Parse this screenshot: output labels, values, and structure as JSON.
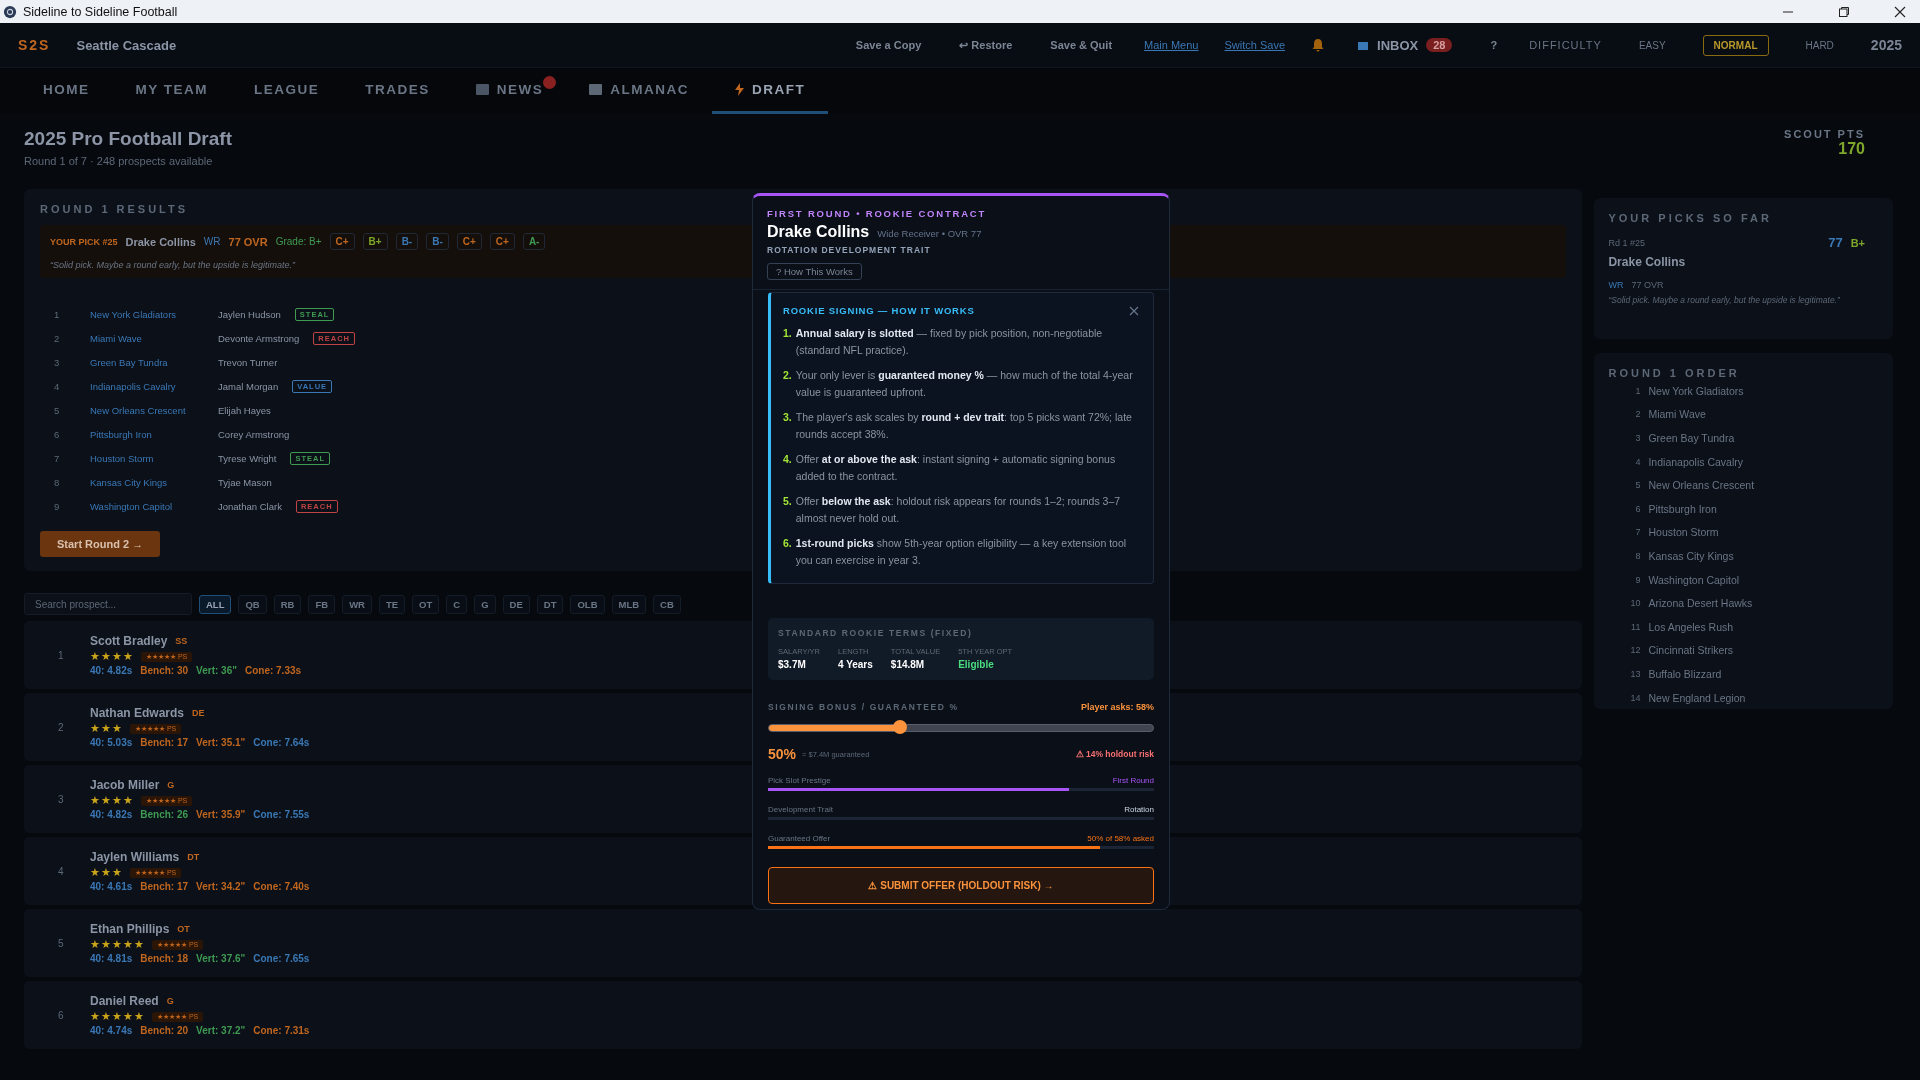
{
  "window": {
    "title": "Sideline to Sideline Football"
  },
  "header": {
    "logo": "S2S",
    "team": "Seattle Cascade",
    "actions": [
      "Save a Copy",
      "↩ Restore",
      "Save & Quit"
    ],
    "links": [
      "Main Menu",
      "Switch Save"
    ],
    "inbox": {
      "label": "INBOX",
      "count": "28"
    },
    "help": "?",
    "difficulty": {
      "label": "DIFFICULTY",
      "options": [
        {
          "label": "EASY",
          "selected": false
        },
        {
          "label": "NORMAL",
          "selected": true
        },
        {
          "label": "HARD",
          "selected": false
        }
      ]
    },
    "year": "2025"
  },
  "tabs": [
    {
      "label": "HOME",
      "selected": false,
      "kind": "plain"
    },
    {
      "label": "MY TEAM",
      "selected": false,
      "kind": "plain"
    },
    {
      "label": "LEAGUE",
      "selected": false,
      "kind": "plain"
    },
    {
      "label": "TRADES",
      "selected": false,
      "kind": "plain"
    },
    {
      "label": "NEWS",
      "selected": false,
      "kind": "news",
      "badge": true
    },
    {
      "label": "ALMANAC",
      "selected": false,
      "kind": "almanac"
    },
    {
      "label": "DRAFT",
      "selected": true,
      "kind": "draft"
    }
  ],
  "page": {
    "title": "2025 Pro Football Draft",
    "subtitle": "Round 1 of 7 · 248 prospects available",
    "scout": {
      "label": "SCOUT PTS",
      "value": "170"
    }
  },
  "results": {
    "title": "ROUND 1 RESULTS",
    "your_pick": {
      "label": "YOUR PICK #25",
      "name": "Drake Collins",
      "pos": "WR",
      "ovr": "77 OVR",
      "grade": "Grade: B+",
      "grades": [
        {
          "label": "C+",
          "color": "#c0661f"
        },
        {
          "label": "B+",
          "color": "#7ea62a"
        },
        {
          "label": "B-",
          "color": "#3a78b5"
        },
        {
          "label": "B-",
          "color": "#3a78b5"
        },
        {
          "label": "C+",
          "color": "#c0661f"
        },
        {
          "label": "C+",
          "color": "#c0661f"
        },
        {
          "label": "A-",
          "color": "#3f9a52"
        }
      ],
      "quote": "“Solid pick. Maybe a round early, but the upside is legitimate.”"
    },
    "picks": [
      {
        "num": "1",
        "team": "New York Gladiators",
        "player": "Jaylen Hudson",
        "tag": "STEAL",
        "color": "#3f9a52"
      },
      {
        "num": "2",
        "team": "Miami Wave",
        "player": "Devonte Armstrong",
        "tag": "REACH",
        "color": "#c04444"
      },
      {
        "num": "3",
        "team": "Green Bay Tundra",
        "player": "Trevon Turner"
      },
      {
        "num": "4",
        "team": "Indianapolis Cavalry",
        "player": "Jamal Morgan",
        "tag": "VALUE",
        "color": "#3a78b5"
      },
      {
        "num": "5",
        "team": "New Orleans Crescent",
        "player": "Elijah Hayes"
      },
      {
        "num": "6",
        "team": "Pittsburgh Iron",
        "player": "Corey Armstrong"
      },
      {
        "num": "7",
        "team": "Houston Storm",
        "player": "Tyrese Wright",
        "tag": "STEAL",
        "color": "#3f9a52"
      },
      {
        "num": "8",
        "team": "Kansas City Kings",
        "player": "Tyjae Mason"
      },
      {
        "num": "9",
        "team": "Washington Capitol",
        "player": "Jonathan Clark",
        "tag": "REACH",
        "color": "#c04444"
      }
    ],
    "next_button": "Start Round 2 →"
  },
  "filters": {
    "search": {
      "placeholder": "Search prospect..."
    },
    "positions": [
      {
        "label": "ALL",
        "selected": true
      },
      {
        "label": "QB",
        "selected": false
      },
      {
        "label": "RB",
        "selected": false
      },
      {
        "label": "FB",
        "selected": false
      },
      {
        "label": "WR",
        "selected": false
      },
      {
        "label": "TE",
        "selected": false
      },
      {
        "label": "OT",
        "selected": false
      },
      {
        "label": "C",
        "selected": false
      },
      {
        "label": "G",
        "selected": false
      },
      {
        "label": "DE",
        "selected": false
      },
      {
        "label": "DT",
        "selected": false
      },
      {
        "label": "OLB",
        "selected": false
      },
      {
        "label": "MLB",
        "selected": false
      },
      {
        "label": "CB",
        "selected": false
      }
    ]
  },
  "prospects": [
    {
      "rank": "1",
      "name": "Scott Bradley",
      "pos": "SS",
      "stars": 4,
      "potential": "★★★★★ PS",
      "stats": [
        {
          "text": "40: 4.82s",
          "color": "#3a78b5"
        },
        {
          "text": "Bench: 30",
          "color": "#c0661f"
        },
        {
          "text": "Vert: 36\"",
          "color": "#3f9a52"
        },
        {
          "text": "Cone: 7.33s",
          "color": "#c0661f"
        }
      ]
    },
    {
      "rank": "2",
      "name": "Nathan Edwards",
      "pos": "DE",
      "stars": 3,
      "potential": "★★★★★ PS",
      "stats": [
        {
          "text": "40: 5.03s",
          "color": "#3a78b5"
        },
        {
          "text": "Bench: 17",
          "color": "#c0661f"
        },
        {
          "text": "Vert: 35.1\"",
          "color": "#c0661f"
        },
        {
          "text": "Cone: 7.64s",
          "color": "#3a78b5"
        }
      ]
    },
    {
      "rank": "3",
      "name": "Jacob Miller",
      "pos": "G",
      "stars": 4,
      "potential": "★★★★★ PS",
      "stats": [
        {
          "text": "40: 4.82s",
          "color": "#3a78b5"
        },
        {
          "text": "Bench: 26",
          "color": "#3f9a52"
        },
        {
          "text": "Vert: 35.9\"",
          "color": "#c0661f"
        },
        {
          "text": "Cone: 7.55s",
          "color": "#3a78b5"
        }
      ]
    },
    {
      "rank": "4",
      "name": "Jaylen Williams",
      "pos": "DT",
      "stars": 3,
      "potential": "★★★★★ PS",
      "stats": [
        {
          "text": "40: 4.61s",
          "color": "#3a78b5"
        },
        {
          "text": "Bench: 17",
          "color": "#c0661f"
        },
        {
          "text": "Vert: 34.2\"",
          "color": "#c0661f"
        },
        {
          "text": "Cone: 7.40s",
          "color": "#c0661f"
        }
      ]
    },
    {
      "rank": "5",
      "name": "Ethan Phillips",
      "pos": "OT",
      "stars": 5,
      "potential": "★★★★★ PS",
      "stats": [
        {
          "text": "40: 4.81s",
          "color": "#3a78b5"
        },
        {
          "text": "Bench: 18",
          "color": "#c0661f"
        },
        {
          "text": "Vert: 37.6\"",
          "color": "#3f9a52"
        },
        {
          "text": "Cone: 7.65s",
          "color": "#3a78b5"
        }
      ]
    },
    {
      "rank": "6",
      "name": "Daniel Reed",
      "pos": "G",
      "stars": 5,
      "potential": "★★★★★ PS",
      "stats": [
        {
          "text": "40: 4.74s",
          "color": "#3a78b5"
        },
        {
          "text": "Bench: 20",
          "color": "#c0661f"
        },
        {
          "text": "Vert: 37.2\"",
          "color": "#3f9a52"
        },
        {
          "text": "Cone: 7.31s",
          "color": "#c0661f"
        }
      ]
    }
  ],
  "sidebar": {
    "picks": {
      "title": "YOUR PICKS SO FAR",
      "round": "Rd 1 #25",
      "ovr": "77",
      "grade": "B+",
      "name": "Drake Collins",
      "pos": "WR",
      "detail": "77 OVR",
      "quote": "“Solid pick. Maybe a round early, but the upside is legitimate.”"
    },
    "order": {
      "title": "ROUND 1 ORDER",
      "teams": [
        {
          "num": "1",
          "name": "New York Gladiators"
        },
        {
          "num": "2",
          "name": "Miami Wave"
        },
        {
          "num": "3",
          "name": "Green Bay Tundra"
        },
        {
          "num": "4",
          "name": "Indianapolis Cavalry"
        },
        {
          "num": "5",
          "name": "New Orleans Crescent"
        },
        {
          "num": "6",
          "name": "Pittsburgh Iron"
        },
        {
          "num": "7",
          "name": "Houston Storm"
        },
        {
          "num": "8",
          "name": "Kansas City Kings"
        },
        {
          "num": "9",
          "name": "Washington Capitol"
        },
        {
          "num": "10",
          "name": "Arizona Desert Hawks"
        },
        {
          "num": "11",
          "name": "Los Angeles Rush"
        },
        {
          "num": "12",
          "name": "Cincinnati Strikers"
        },
        {
          "num": "13",
          "name": "Buffalo Blizzard"
        },
        {
          "num": "14",
          "name": "New England Legion"
        }
      ]
    }
  },
  "modal": {
    "kicker": "FIRST ROUND • ROOKIE CONTRACT",
    "name": "Drake Collins",
    "subtitle": "Wide Receiver • OVR 77",
    "trait": "ROTATION DEVELOPMENT TRAIT",
    "help_button": "? How This Works",
    "info": {
      "title": "ROOKIE SIGNING — HOW IT WORKS",
      "steps": [
        {
          "num": "1.",
          "text": "**Annual salary is slotted** — fixed by pick position, non-negotiable (standard NFL practice)."
        },
        {
          "num": "2.",
          "text": "Your only lever is **guaranteed money %** — how much of the total 4-year value is guaranteed upfront."
        },
        {
          "num": "3.",
          "text": "The player's ask scales by **round + dev trait**: top 5 picks want 72%; late rounds accept 38%."
        },
        {
          "num": "4.",
          "text": "Offer **at or above the ask**: instant signing + automatic signing bonus added to the contract."
        },
        {
          "num": "5.",
          "text": "Offer **below the ask**: holdout risk appears for rounds 1–2; rounds 3–7 almost never hold out."
        },
        {
          "num": "6.",
          "text": "**1st-round picks** show 5th-year option eligibility — a key extension tool you can exercise in year 3."
        }
      ]
    },
    "terms": {
      "title": "STANDARD ROOKIE TERMS (FIXED)",
      "items": [
        {
          "label": "SALARY/YR",
          "value": "$3.7M",
          "color": "#ffffff"
        },
        {
          "label": "LENGTH",
          "value": "4 Years",
          "color": "#ffffff"
        },
        {
          "label": "TOTAL VALUE",
          "value": "$14.8M",
          "color": "#ffffff"
        },
        {
          "label": "5TH YEAR OPT",
          "value": "Eligible",
          "color": "#4ade80"
        }
      ]
    },
    "slider": {
      "label": "SIGNING BONUS / GUARANTEED %",
      "ask": "Player asks: 58%",
      "level": 0.34,
      "value": "50%",
      "note": "= $7.4M guaranteed",
      "risk": "⚠ 14% holdout risk"
    },
    "bars": [
      {
        "label": "Pick Slot Prestige",
        "value": "First Round",
        "level": 0.78,
        "color": "#a855f7"
      },
      {
        "label": "Development Trait",
        "value": "Rotation"
      },
      {
        "label": "Guaranteed Offer",
        "value": "50% of 58% asked",
        "level": 0.86,
        "color": "#f97316"
      }
    ],
    "submit": "⚠ SUBMIT OFFER (HOLDOUT RISK) →"
  }
}
